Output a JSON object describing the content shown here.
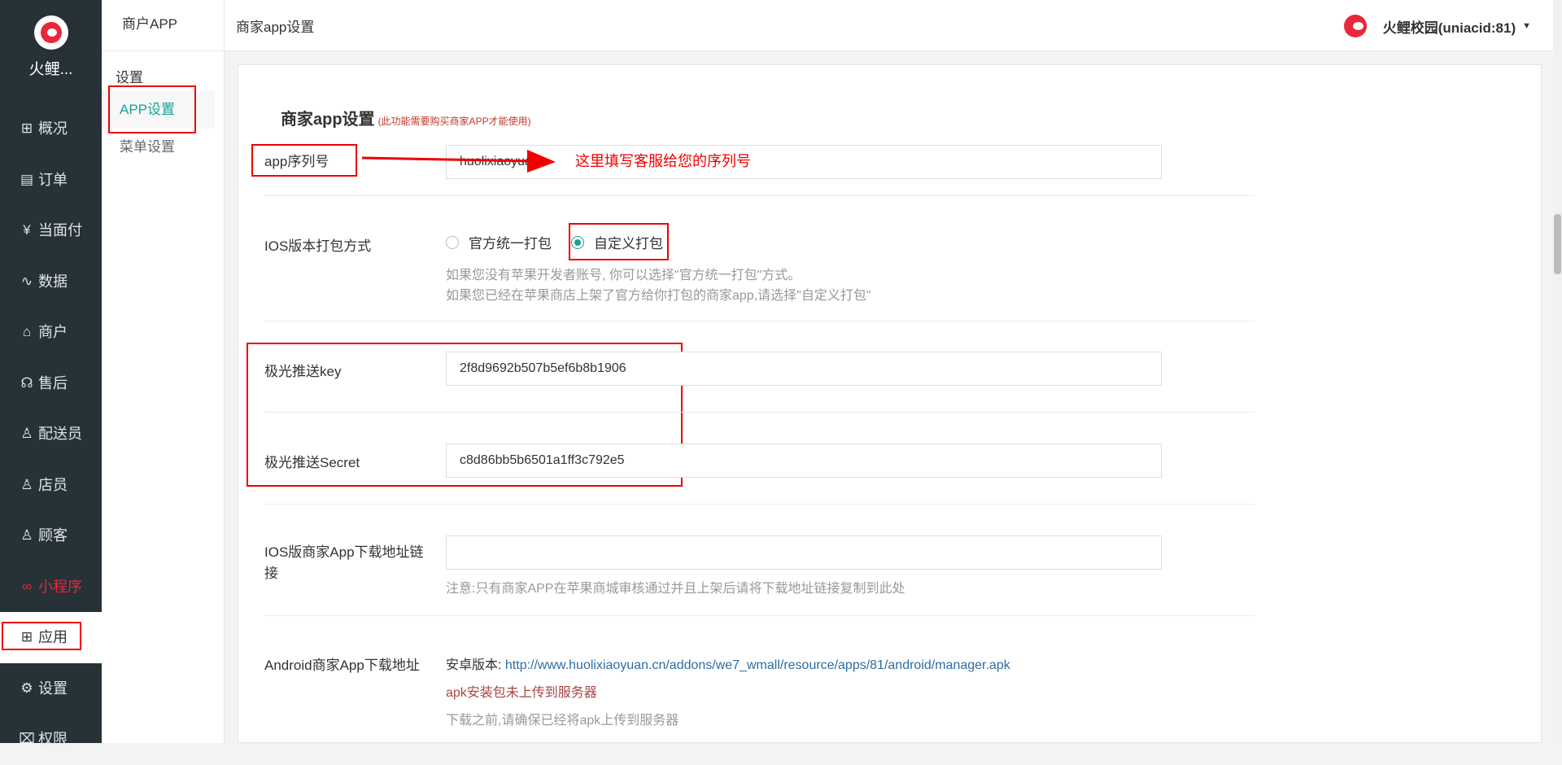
{
  "sidebar": {
    "brand": "火鲤...",
    "items": [
      {
        "label": "概况",
        "icon": "overview-icon",
        "glyph": "⊞"
      },
      {
        "label": "订单",
        "icon": "order-icon",
        "glyph": "▤"
      },
      {
        "label": "当面付",
        "icon": "yen-icon",
        "glyph": "¥"
      },
      {
        "label": "数据",
        "icon": "chart-icon",
        "glyph": "∿"
      },
      {
        "label": "商户",
        "icon": "store-icon",
        "glyph": "⌂"
      },
      {
        "label": "售后",
        "icon": "headset-icon",
        "glyph": "☊"
      },
      {
        "label": "配送员",
        "icon": "courier-icon",
        "glyph": "♙"
      },
      {
        "label": "店员",
        "icon": "staff-icon",
        "glyph": "♙"
      },
      {
        "label": "顾客",
        "icon": "customer-icon",
        "glyph": "♙"
      },
      {
        "label": "小程序",
        "icon": "miniprogram-icon",
        "glyph": "∞"
      },
      {
        "label": "应用",
        "icon": "apps-icon",
        "glyph": "⊞"
      },
      {
        "label": "设置",
        "icon": "gear-icon",
        "glyph": "⚙"
      },
      {
        "label": "权限",
        "icon": "lock-icon",
        "glyph": "⌧"
      }
    ]
  },
  "subnav": {
    "title": "商户APP",
    "group": "设置",
    "items": [
      "APP设置",
      "菜单设置"
    ]
  },
  "header": {
    "breadcrumb": "商家app设置",
    "user": "火鲤校园(uniacid:81)"
  },
  "form": {
    "title": "商家app设置",
    "title_note": "(此功能需要购买商家APP才能使用)",
    "serial_label": "app序列号",
    "serial_value": "huolixiaoyuan",
    "serial_annotation": "这里填写客服给您的序列号",
    "ios_pack_label": "IOS版本打包方式",
    "ios_pack_options": [
      "官方统一打包",
      "自定义打包"
    ],
    "ios_pack_help_1": "如果您没有苹果开发者账号, 你可以选择\"官方统一打包\"方式。",
    "ios_pack_help_2": "如果您已经在苹果商店上架了官方给你打包的商家app,请选择\"自定义打包\"",
    "jpush_key_label": "极光推送key",
    "jpush_key_value": "2f8d9692b507b5ef6b8b1906",
    "jpush_secret_label": "极光推送Secret",
    "jpush_secret_value": "c8d86bb5b6501a1ff3c792e5",
    "ios_url_label": "IOS版商家App下载地址链接",
    "ios_url_value": "",
    "ios_url_help": "注意:只有商家APP在苹果商城审核通过并且上架后请将下载地址链接复制到此处",
    "android_label": "Android商家App下载地址",
    "android_prefix": "安卓版本:",
    "android_url": "http://www.huolixiaoyuan.cn/addons/we7_wmall/resource/apps/81/android/manager.apk",
    "android_warning": "apk安装包未上传到服务器",
    "android_help": "下载之前,请确保已经将apk上传到服务器"
  }
}
